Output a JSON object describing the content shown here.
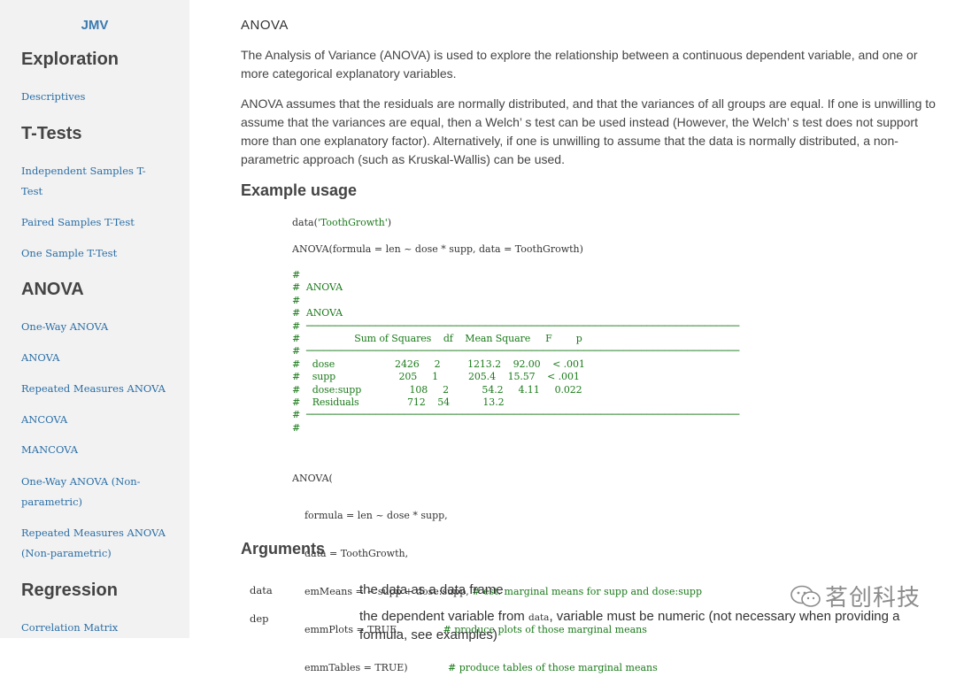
{
  "sidebar": {
    "brand": "JMV",
    "sections": [
      {
        "title": "Exploration",
        "items": [
          "Descriptives"
        ]
      },
      {
        "title": "T-Tests",
        "items": [
          "Independent Samples T-Test",
          "Paired Samples T-Test",
          "One Sample T-Test"
        ]
      },
      {
        "title": "ANOVA",
        "items": [
          "One-Way ANOVA",
          "ANOVA",
          "Repeated Measures ANOVA",
          "ANCOVA",
          "MANCOVA",
          "One-Way ANOVA (Non-parametric)",
          "Repeated Measures ANOVA (Non-parametric)"
        ]
      },
      {
        "title": "Regression",
        "items": [
          "Correlation Matrix"
        ]
      }
    ]
  },
  "main": {
    "heading": "ANOVA",
    "paragraph1": "The Analysis of Variance (ANOVA) is used to explore the relationship between a continuous dependent variable, and one or more categorical explanatory variables.",
    "paragraph2": "ANOVA assumes that the residuals are normally distributed, and that the variances of all groups are equal. If one is unwilling to assume that the variances are equal, then a Welch’ s test can be used instead (However, the Welch’ s test does not support more than one explanatory factor). Alternatively, if one is unwilling to assume that the data is normally distributed, a non-parametric approach (such as Kruskal-Wallis) can be used.",
    "example_heading": "Example usage",
    "code": {
      "line_data_prefix": "data(",
      "line_data_arg": "'ToothGrowth'",
      "line_data_suffix": ")",
      "line_anova_call": "ANOVA(formula = len ~ dose * supp, data = ToothGrowth)",
      "output_block": "#\n#  ANOVA\n#\n#  ANOVA\n#  ───────────────────────────────────────────────────────────────────────────\n#                  Sum of Squares    df    Mean Square     F        p\n#  ───────────────────────────────────────────────────────────────────────────\n#    dose                    2426     2         1213.2    92.00    < .001\n#    supp                     205     1          205.4    15.57    < .001\n#    dose:supp                108     2           54.2     4.11     0.022\n#    Residuals                712    54           13.2\n#  ───────────────────────────────────────────────────────────────────────────\n#",
      "call2_lines": [
        {
          "code": "ANOVA(",
          "comment": ""
        },
        {
          "code": "    formula = len ~ dose * supp,",
          "comment": ""
        },
        {
          "code": "    data = ToothGrowth,",
          "comment": ""
        },
        {
          "code": "    emMeans = ~ supp + dose:supp, ",
          "comment": "# est. marginal means for supp and dose:supp"
        },
        {
          "code": "    emmPlots = TRUE,              ",
          "comment": "# produce plots of those marginal means"
        },
        {
          "code": "    emmTables = TRUE)             ",
          "comment": "# produce tables of those marginal means"
        }
      ]
    },
    "arguments_heading": "Arguments",
    "arguments": [
      {
        "name": "data",
        "desc": "the data as a data frame"
      },
      {
        "name": "dep",
        "desc_prefix": "the dependent variable from ",
        "desc_code": "data",
        "desc_suffix": ", variable must be numeric (not necessary when providing a formula, see examples)"
      }
    ]
  },
  "watermark": {
    "text": "茗创科技",
    "icon": "wechat-icon"
  }
}
